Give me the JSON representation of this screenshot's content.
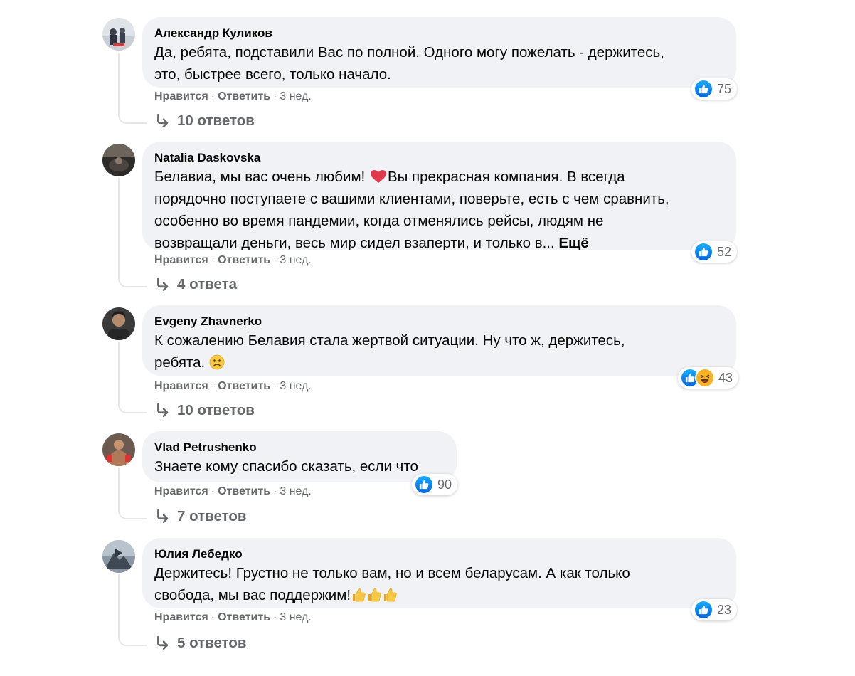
{
  "comments": [
    {
      "author": "Александр Куликов",
      "lines": [
        "Да, ребята, подставили Вас по полной. Одного могу пожелать - держитесь,",
        "это, быстрее всего, только начало."
      ],
      "reaction_count": "75",
      "like": "Нравится",
      "reply": "Ответить",
      "time": "3 нед.",
      "replies": "10 ответов"
    },
    {
      "author": "Natalia Daskovska",
      "line1_a": "Белавиа, мы вас очень любим! ",
      "line1_b": "Вы прекрасная компания. В всегда",
      "lines": [
        "порядочно поступаете с вашими клиентами, поверьте, есть с чем сравнить,",
        "особенно во время пандемии, когда отменялись рейсы, людям не"
      ],
      "line4": "возвращали деньги, весь мир сидел взаперти, и только в... ",
      "more": "Ещё",
      "reaction_count": "52",
      "like": "Нравится",
      "reply": "Ответить",
      "time": "3 нед.",
      "replies": "4 ответа"
    },
    {
      "author": "Evgeny Zhavnerko",
      "lines": [
        "К сожалению Белавия стала жертвой ситуации. Ну что ж, держитесь,"
      ],
      "line2": "ребята. ",
      "reaction_count": "43",
      "like": "Нравится",
      "reply": "Ответить",
      "time": "3 нед.",
      "replies": "10 ответов"
    },
    {
      "author": "Vlad Petrushenko",
      "lines": [
        "Знаете кому спасибо сказать, если что"
      ],
      "reaction_count": "90",
      "like": "Нравится",
      "reply": "Ответить",
      "time": "3 нед.",
      "replies": "7 ответов"
    },
    {
      "author": "Юлия Лебедко",
      "lines": [
        "Держитесь! Грустно не только вам, но и всем беларусам. А как только"
      ],
      "line2": "свобода, мы вас поддержим!",
      "reaction_count": "23",
      "like": "Нравится",
      "reply": "Ответить",
      "time": "3 нед.",
      "replies": "5 ответов"
    }
  ],
  "separator": "·",
  "colors": {
    "bubble": "#f0f2f5",
    "secondary_text": "#65676b",
    "like_blue": "#1877f2"
  },
  "icons": [
    "avatar",
    "like-icon",
    "haha-icon",
    "heart-emoji",
    "confused-emoji",
    "thumbs-up-emoji",
    "reply-arrow-icon"
  ]
}
